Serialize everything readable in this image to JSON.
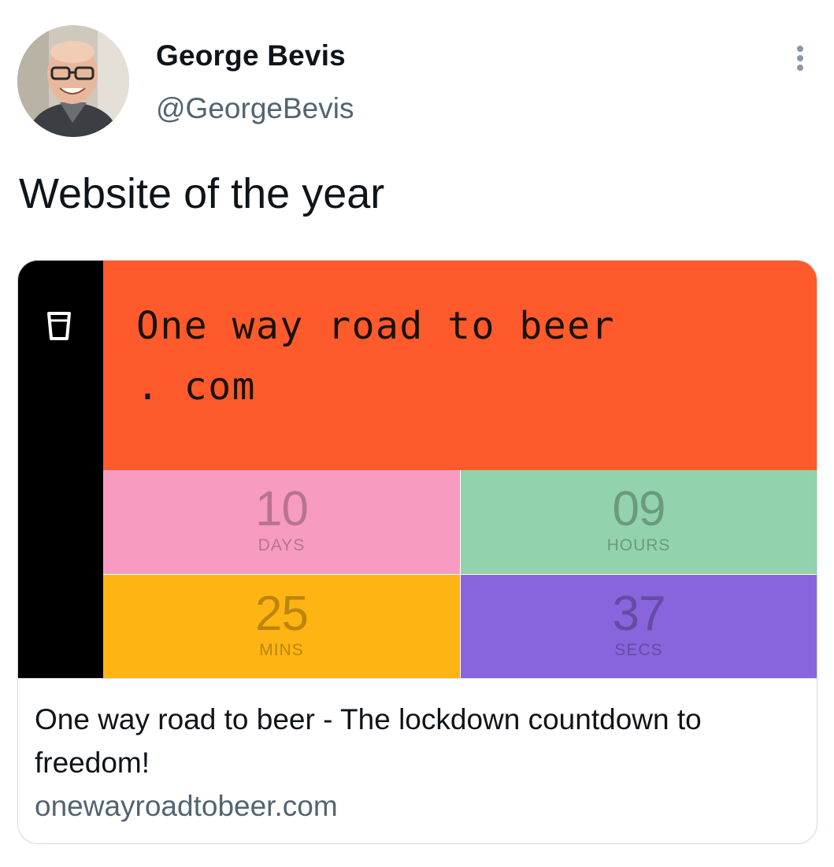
{
  "author": {
    "display_name": "George Bevis",
    "handle": "@GeorgeBevis",
    "avatar_icon": "profile-photo"
  },
  "tweet": {
    "text": "Website of the year"
  },
  "more_icon": "more-vertical-icon",
  "card": {
    "site_title_line1": "One way road to beer",
    "site_title_line2": ". com",
    "glass_icon": "beer-glass-icon",
    "countdown": [
      {
        "value": "10",
        "label": "DAYS",
        "bg": "#f79bc1",
        "fg": "#b7748f"
      },
      {
        "value": "09",
        "label": "HOURS",
        "bg": "#92d2ac",
        "fg": "#6b9a7e"
      },
      {
        "value": "25",
        "label": "MINS",
        "bg": "#feb412",
        "fg": "#bc850e"
      },
      {
        "value": "37",
        "label": "SECS",
        "bg": "#8865dc",
        "fg": "#654ba3"
      }
    ],
    "colors": {
      "sidebar": "#000000",
      "header": "#ff5a2b"
    },
    "title": "One way road to beer - The lockdown countdown to freedom!",
    "domain": "onewayroadtobeer.com"
  }
}
